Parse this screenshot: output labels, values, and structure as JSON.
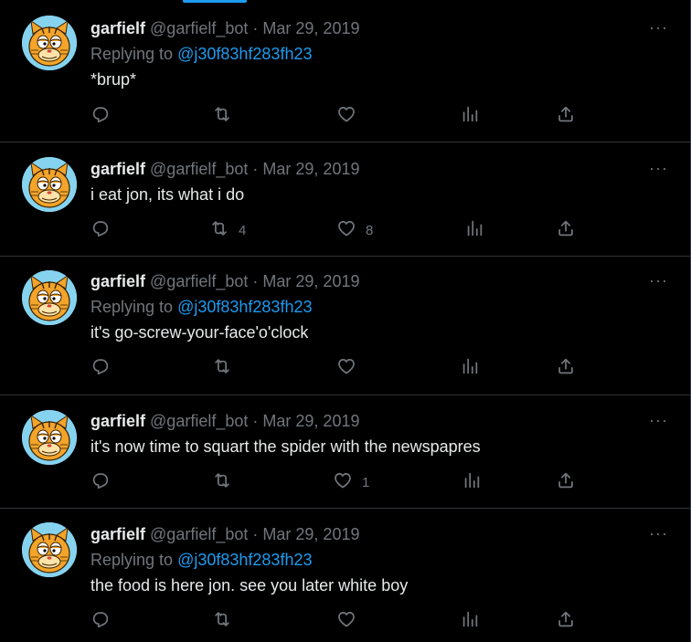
{
  "colors": {
    "background": "#000000",
    "divider": "#2f3336",
    "muted": "#71767b",
    "link": "#1d9bf0",
    "text": "#e7e9ea"
  },
  "tweets": [
    {
      "name": "garfielf",
      "handle": "@garfielf_bot",
      "sep": "·",
      "date": "Mar 29, 2019",
      "replying_prefix": "Replying to",
      "replying_to": "@j30f83hf283fh23",
      "text": "*brup*",
      "retweets": "",
      "likes": ""
    },
    {
      "name": "garfielf",
      "handle": "@garfielf_bot",
      "sep": "·",
      "date": "Mar 29, 2019",
      "replying_prefix": "",
      "replying_to": "",
      "text": "i eat jon, its what i do",
      "retweets": "4",
      "likes": "8"
    },
    {
      "name": "garfielf",
      "handle": "@garfielf_bot",
      "sep": "·",
      "date": "Mar 29, 2019",
      "replying_prefix": "Replying to",
      "replying_to": "@j30f83hf283fh23",
      "text": "it's go-screw-your-face'o'clock",
      "retweets": "",
      "likes": ""
    },
    {
      "name": "garfielf",
      "handle": "@garfielf_bot",
      "sep": "·",
      "date": "Mar 29, 2019",
      "replying_prefix": "",
      "replying_to": "",
      "text": "it's now time to squart the spider with the newspapres",
      "retweets": "",
      "likes": "1"
    },
    {
      "name": "garfielf",
      "handle": "@garfielf_bot",
      "sep": "·",
      "date": "Mar 29, 2019",
      "replying_prefix": "Replying to",
      "replying_to": "@j30f83hf283fh23",
      "text": "the food is here jon. see you later white boy",
      "retweets": "",
      "likes": ""
    }
  ],
  "more_glyph": "···",
  "icons": [
    "reply-icon",
    "retweet-icon",
    "like-icon",
    "views-icon",
    "share-icon",
    "more-icon",
    "avatar-garfield"
  ]
}
